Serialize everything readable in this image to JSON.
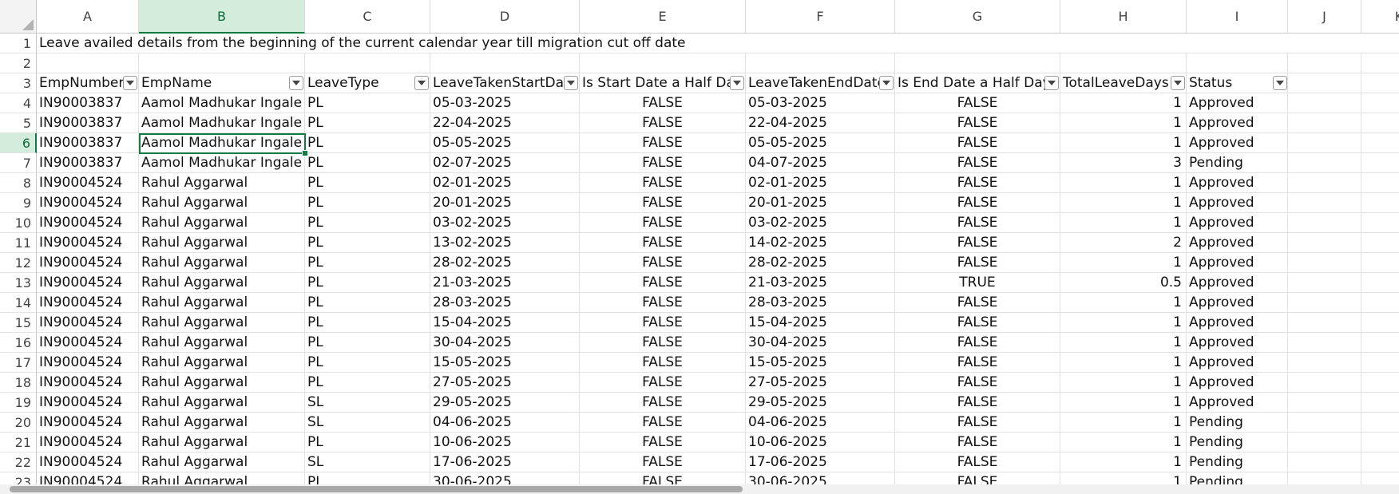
{
  "columns": [
    "A",
    "B",
    "C",
    "D",
    "E",
    "F",
    "G",
    "H",
    "I",
    "J",
    "K"
  ],
  "selected_column": "B",
  "selected_row": 6,
  "row_numbers": [
    1,
    2,
    3,
    4,
    5,
    6,
    7,
    8,
    9,
    10,
    11,
    12,
    13,
    14,
    15,
    16,
    17,
    18,
    19,
    20,
    21,
    22,
    23
  ],
  "title": "Leave availed details from the beginning of the current calendar year till migration cut off date",
  "headers": [
    "EmpNumber",
    "EmpName",
    "LeaveType",
    "LeaveTakenStartDate",
    "Is Start Date a Half Day",
    "LeaveTakenEndDate",
    "Is End Date a Half Day",
    "TotalLeaveDays",
    "Status"
  ],
  "rows": [
    [
      "IN90003837",
      "Aamol Madhukar Ingale",
      "PL",
      "05-03-2025",
      "FALSE",
      "05-03-2025",
      "FALSE",
      "1",
      "Approved"
    ],
    [
      "IN90003837",
      "Aamol Madhukar Ingale",
      "PL",
      "22-04-2025",
      "FALSE",
      "22-04-2025",
      "FALSE",
      "1",
      "Approved"
    ],
    [
      "IN90003837",
      "Aamol Madhukar Ingale",
      "PL",
      "05-05-2025",
      "FALSE",
      "05-05-2025",
      "FALSE",
      "1",
      "Approved"
    ],
    [
      "IN90003837",
      "Aamol Madhukar Ingale",
      "PL",
      "02-07-2025",
      "FALSE",
      "04-07-2025",
      "FALSE",
      "3",
      "Pending"
    ],
    [
      "IN90004524",
      "Rahul  Aggarwal",
      "PL",
      "02-01-2025",
      "FALSE",
      "02-01-2025",
      "FALSE",
      "1",
      "Approved"
    ],
    [
      "IN90004524",
      "Rahul  Aggarwal",
      "PL",
      "20-01-2025",
      "FALSE",
      "20-01-2025",
      "FALSE",
      "1",
      "Approved"
    ],
    [
      "IN90004524",
      "Rahul  Aggarwal",
      "PL",
      "03-02-2025",
      "FALSE",
      "03-02-2025",
      "FALSE",
      "1",
      "Approved"
    ],
    [
      "IN90004524",
      "Rahul  Aggarwal",
      "PL",
      "13-02-2025",
      "FALSE",
      "14-02-2025",
      "FALSE",
      "2",
      "Approved"
    ],
    [
      "IN90004524",
      "Rahul  Aggarwal",
      "PL",
      "28-02-2025",
      "FALSE",
      "28-02-2025",
      "FALSE",
      "1",
      "Approved"
    ],
    [
      "IN90004524",
      "Rahul  Aggarwal",
      "PL",
      "21-03-2025",
      "FALSE",
      "21-03-2025",
      "TRUE",
      "0.5",
      "Approved"
    ],
    [
      "IN90004524",
      "Rahul  Aggarwal",
      "PL",
      "28-03-2025",
      "FALSE",
      "28-03-2025",
      "FALSE",
      "1",
      "Approved"
    ],
    [
      "IN90004524",
      "Rahul  Aggarwal",
      "PL",
      "15-04-2025",
      "FALSE",
      "15-04-2025",
      "FALSE",
      "1",
      "Approved"
    ],
    [
      "IN90004524",
      "Rahul  Aggarwal",
      "PL",
      "30-04-2025",
      "FALSE",
      "30-04-2025",
      "FALSE",
      "1",
      "Approved"
    ],
    [
      "IN90004524",
      "Rahul  Aggarwal",
      "PL",
      "15-05-2025",
      "FALSE",
      "15-05-2025",
      "FALSE",
      "1",
      "Approved"
    ],
    [
      "IN90004524",
      "Rahul  Aggarwal",
      "PL",
      "27-05-2025",
      "FALSE",
      "27-05-2025",
      "FALSE",
      "1",
      "Approved"
    ],
    [
      "IN90004524",
      "Rahul  Aggarwal",
      "SL",
      "29-05-2025",
      "FALSE",
      "29-05-2025",
      "FALSE",
      "1",
      "Approved"
    ],
    [
      "IN90004524",
      "Rahul  Aggarwal",
      "SL",
      "04-06-2025",
      "FALSE",
      "04-06-2025",
      "FALSE",
      "1",
      "Pending"
    ],
    [
      "IN90004524",
      "Rahul  Aggarwal",
      "PL",
      "10-06-2025",
      "FALSE",
      "10-06-2025",
      "FALSE",
      "1",
      "Pending"
    ],
    [
      "IN90004524",
      "Rahul  Aggarwal",
      "SL",
      "17-06-2025",
      "FALSE",
      "17-06-2025",
      "FALSE",
      "1",
      "Pending"
    ],
    [
      "IN90004524",
      "Rahul  Aggarwal",
      "PL",
      "30-06-2025",
      "FALSE",
      "30-06-2025",
      "FALSE",
      "1",
      "Pending"
    ]
  ],
  "icons": {
    "filter": "filter-dropdown-icon",
    "select_all": "select-all-corner-icon"
  },
  "colors": {
    "selection": "#107c41",
    "selected_header_bg": "#d3ecdc",
    "gridline": "#e1e1e1"
  }
}
